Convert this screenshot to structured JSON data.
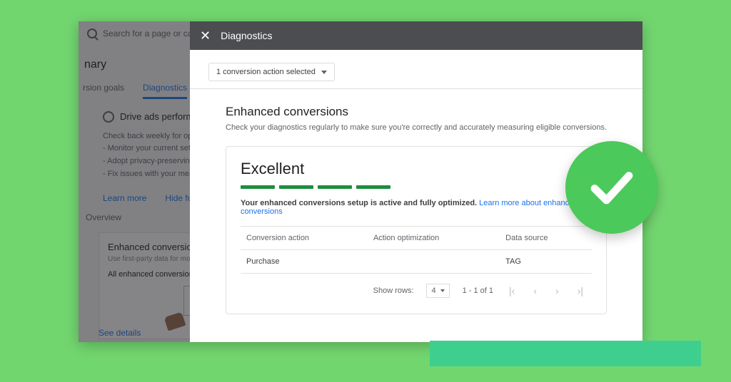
{
  "background": {
    "search_placeholder": "Search for a page or campaign",
    "section_title": "nary",
    "tabs": {
      "goals": "rsion goals",
      "diagnostics": "Diagnostics"
    },
    "drive_card": {
      "heading": "Drive ads performanc",
      "line1": "Check back weekly for opportuni",
      "bul1": "Monitor your current setup",
      "bul2": "Adopt privacy-preserving soluti",
      "bul3": "Fix issues with your measurem",
      "learn": "Learn more",
      "hide": "Hide for"
    },
    "overview_label": "Overview",
    "enh_card": {
      "title": "Enhanced conversions",
      "sub": "Use first-party data for more accurate",
      "line": "All enhanced conversion ac"
    },
    "see_details": "See details"
  },
  "panel": {
    "title": "Diagnostics",
    "selector_label": "1 conversion action selected",
    "section_title": "Enhanced conversions",
    "section_sub": "Check your diagnostics regularly to make sure you're correctly and accurately measuring eligible conversions.",
    "status_title": "Excellent",
    "status_msg_bold": "Your enhanced conversions setup is active and fully optimized.",
    "status_link": "Learn more about enhanced conversions",
    "table": {
      "col1": "Conversion action",
      "col2": "Action optimization",
      "col3": "Data source",
      "row1": {
        "action": "Purchase",
        "opt": "",
        "source": "TAG"
      }
    },
    "pager": {
      "show_rows": "Show rows:",
      "rows_value": "4",
      "range": "1 - 1 of 1"
    }
  }
}
